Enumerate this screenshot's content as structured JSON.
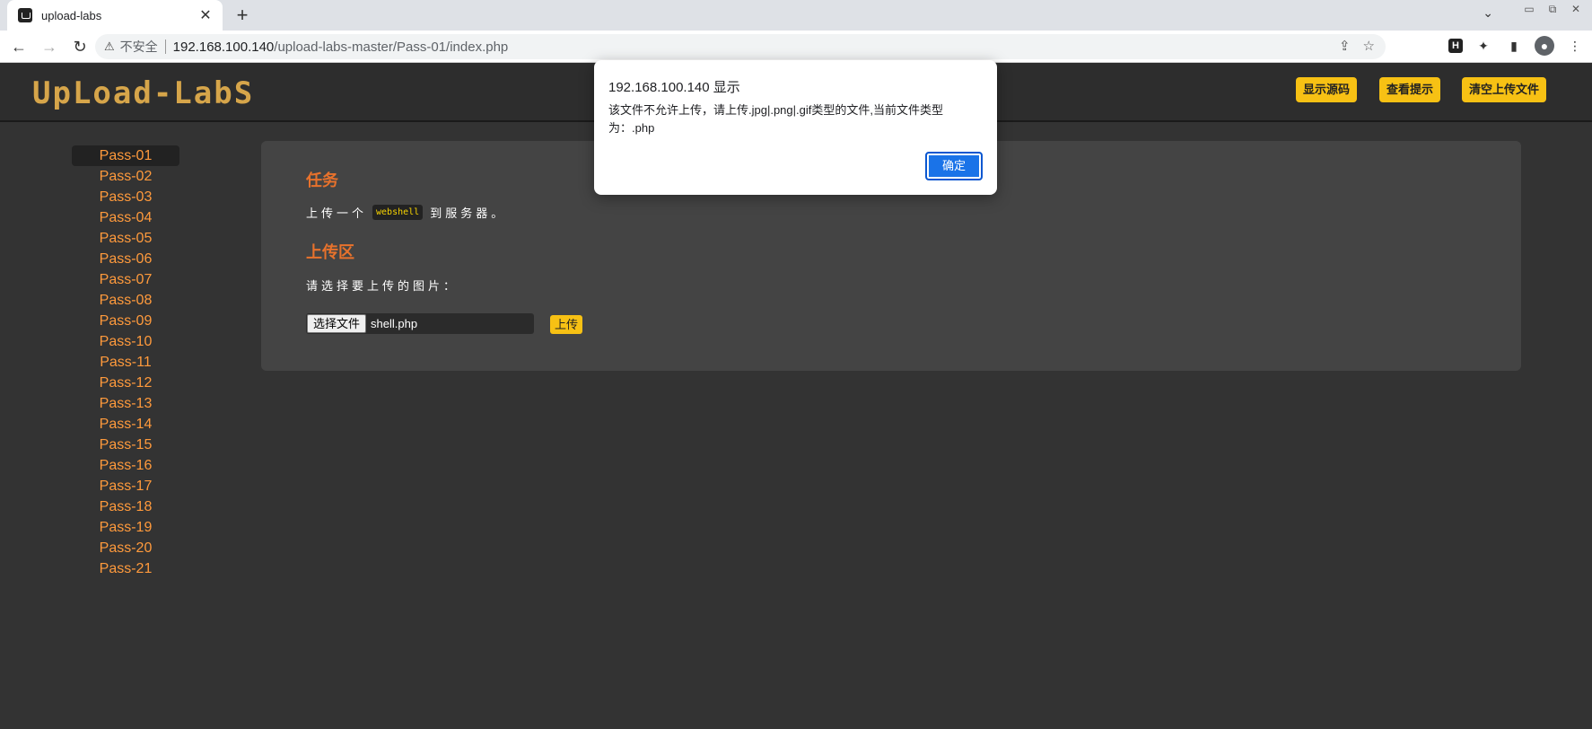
{
  "browser": {
    "tab_title": "upload-labs",
    "tab_close": "✕",
    "new_tab": "+",
    "tab_dropdown": "⌄",
    "window_controls": [
      "▭",
      "⧉",
      "✕"
    ],
    "nav": {
      "back": "←",
      "forward": "→",
      "reload": "↻"
    },
    "security_icon": "⚠",
    "security_label": "不安全",
    "url_host": "192.168.100.140",
    "url_path": "/upload-labs-master/Pass-01/index.php",
    "omnibox_icons": {
      "share": "⇪",
      "bookmark": "☆"
    },
    "toolbar_icons": {
      "extension_h": "H",
      "puzzle": "✦",
      "sidepanel": "▮",
      "profile": "●",
      "menu": "⋮"
    }
  },
  "header": {
    "logo": "UpLoad-LabS",
    "buttons": {
      "show_source": "显示源码",
      "show_hint": "查看提示",
      "clear_uploads": "清空上传文件"
    }
  },
  "sidebar": {
    "items": [
      "Pass-01",
      "Pass-02",
      "Pass-03",
      "Pass-04",
      "Pass-05",
      "Pass-06",
      "Pass-07",
      "Pass-08",
      "Pass-09",
      "Pass-10",
      "Pass-11",
      "Pass-12",
      "Pass-13",
      "Pass-14",
      "Pass-15",
      "Pass-16",
      "Pass-17",
      "Pass-18",
      "Pass-19",
      "Pass-20",
      "Pass-21"
    ],
    "active_index": 0
  },
  "main": {
    "task_heading": "任务",
    "task_prefix": "上传一个",
    "task_code": "webshell",
    "task_suffix": "到服务器。",
    "upload_heading": "上传区",
    "choose_prompt": "请选择要上传的图片：",
    "file_button": "选择文件",
    "file_name": "shell.php",
    "upload_button": "上传"
  },
  "dialog": {
    "title": "192.168.100.140 显示",
    "message": "该文件不允许上传，请上传.jpg|.png|.gif类型的文件,当前文件类型为：.php",
    "ok": "确定"
  },
  "colors": {
    "page_bg": "#333333",
    "panel_bg": "#444444",
    "accent_yellow": "#f7c114",
    "heading_orange": "#e8722c",
    "sidebar_link": "#ff9a3c",
    "dialog_ok": "#1a73e8"
  }
}
